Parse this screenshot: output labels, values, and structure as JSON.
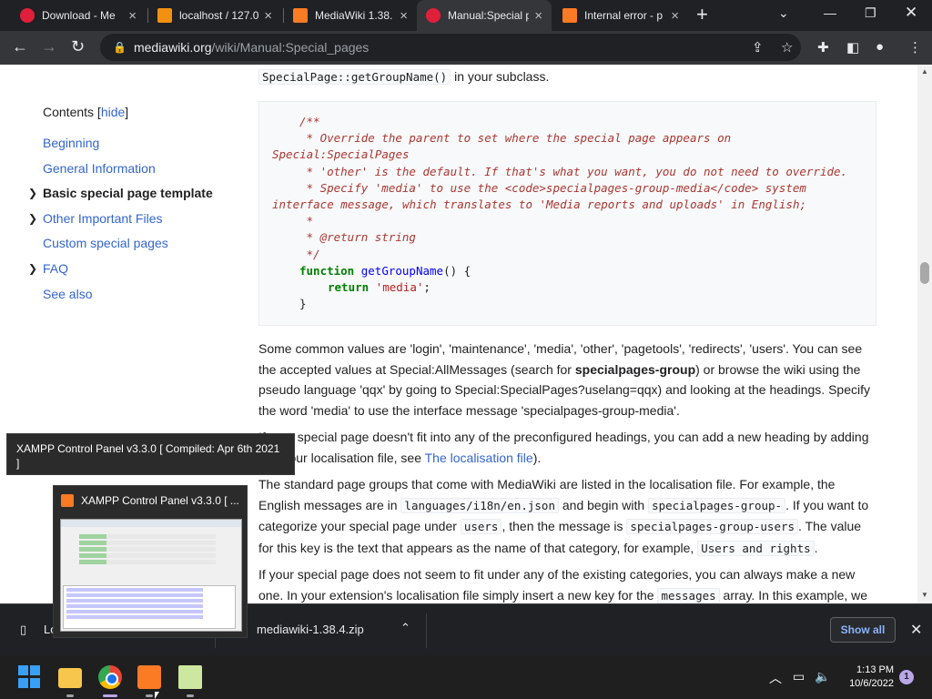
{
  "browser": {
    "tabs": [
      {
        "title": "Download - Me",
        "active": false,
        "icon": "opera-icon"
      },
      {
        "title": "localhost / 127.0",
        "active": false,
        "icon": "phpmyadmin-icon"
      },
      {
        "title": "MediaWiki 1.38.",
        "active": false,
        "icon": "xampp-icon"
      },
      {
        "title": "Manual:Special p",
        "active": true,
        "icon": "opera-icon"
      },
      {
        "title": "Internal error - p",
        "active": false,
        "icon": "xampp-icon"
      }
    ],
    "url_host": "mediawiki.org",
    "url_path": "/wiki/Manual:Special_pages"
  },
  "toc": {
    "heading": "Contents",
    "hide_link": "hide",
    "items": [
      {
        "label": "Beginning",
        "current": false,
        "expandable": false
      },
      {
        "label": "General Information",
        "current": false,
        "expandable": false
      },
      {
        "label": "Basic special page template",
        "current": true,
        "expandable": true
      },
      {
        "label": "Other Important Files",
        "current": false,
        "expandable": true
      },
      {
        "label": "Custom special pages",
        "current": false,
        "expandable": false
      },
      {
        "label": "FAQ",
        "current": false,
        "expandable": true
      },
      {
        "label": "See also",
        "current": false,
        "expandable": false
      }
    ]
  },
  "content": {
    "intro_code": "SpecialPage::getGroupName()",
    "intro_text": "in your subclass.",
    "code": {
      "c1": "/**",
      "c2": " * Override the parent to set where the special page appears on",
      "c3": "Special:SpecialPages",
      "c4": " * 'other' is the default. If that's what you want, you do not need to override.",
      "c5": " * Specify 'media' to use the <code>specialpages-group-media</code> system",
      "c6": "interface message, which translates to 'Media reports and uploads' in English;",
      "c7": " *",
      "c8": " * @return string",
      "c9": " */",
      "kw_function": "function",
      "fn_name": "getGroupName",
      "fn_args": "() {",
      "kw_return": "return",
      "ret_val": "'media'",
      "semi": ";",
      "close": "}"
    },
    "p1_a": "Some common values are 'login', 'maintenance', 'media', 'other', 'pagetools', 'redirects', 'users'. You can see the accepted values at Special:AllMessages (search for ",
    "p1_bold": "specialpages-group",
    "p1_b": ") or browse the wiki using the pseudo language 'qqx' by going to Special:SpecialPages?uselang=qqx) and looking at the headings. Specify the word 'media' to use the interface message 'specialpages-group-media'.",
    "p2_a": "If your special page doesn't fit into any of the preconfigured headings, you can add a new heading by adding it to your localisation file, see ",
    "p2_link": "The localisation file",
    "p2_b": ").",
    "p3_a": "The standard page groups that come with MediaWiki are listed in the localisation file. For example, the English messages are in ",
    "p3_code1": "languages/i18n/en.json",
    "p3_b": " and begin with ",
    "p3_code2": "specialpages-group-",
    "p3_c": ". If you want to categorize your special page under ",
    "p3_code3": "users",
    "p3_d": ", then the message is ",
    "p3_code4": "specialpages-group-users",
    "p3_e": ". The value for this key is the text that appears as the name of that category, for example, ",
    "p3_code5": "Users and rights",
    "p3_f": ".",
    "p4_a": "If your special page does not seem to fit under any of the existing categories, you can always make a new one. In your extension's localisation file simply insert a new key for the ",
    "p4_code": "messages",
    "p4_b": " array. In this example, we"
  },
  "tooltip": {
    "line1": "XAMPP Control Panel v3.3.0   [ Compiled: Apr 6th 2021",
    "line2": "]"
  },
  "preview": {
    "title": "XAMPP Control Panel v3.3.0   [ ..."
  },
  "downloads": {
    "file1": "Lo",
    "file2": "mediawiki-1.38.4.zip",
    "show_all": "Show all"
  },
  "taskbar": {
    "time": "1:13 PM",
    "date": "10/6/2022",
    "notifications": "1"
  },
  "colors": {
    "link": "#3366cc",
    "chrome_dark": "#202124",
    "accent_blue": "#8ab4f8"
  }
}
